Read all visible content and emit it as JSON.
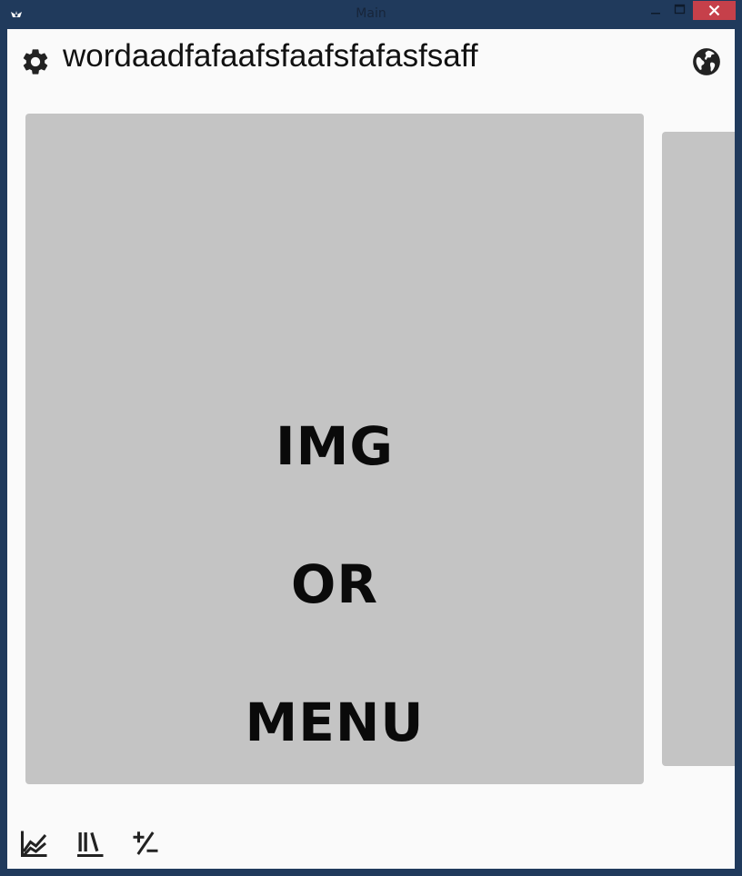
{
  "window": {
    "title": "Main",
    "controls": [
      "minimize-icon",
      "maximize-icon",
      "close-icon"
    ],
    "close_color": "#c6404a",
    "frame_color": "#203a5c"
  },
  "header": {
    "title": "wordaadfafaafsfaafsfafasfsaff",
    "left_icon": "gear-icon",
    "right_icon": "globe-icon"
  },
  "carousel": {
    "card_color": "#c4c4c4",
    "cards": [
      {
        "lines": [
          "IMG",
          "OR",
          "MENU"
        ]
      },
      {
        "lines": []
      }
    ]
  },
  "bottom_bar": {
    "items": [
      {
        "icon": "chart-line-icon"
      },
      {
        "icon": "library-icon"
      },
      {
        "icon": "plus-minus-icon"
      }
    ]
  }
}
